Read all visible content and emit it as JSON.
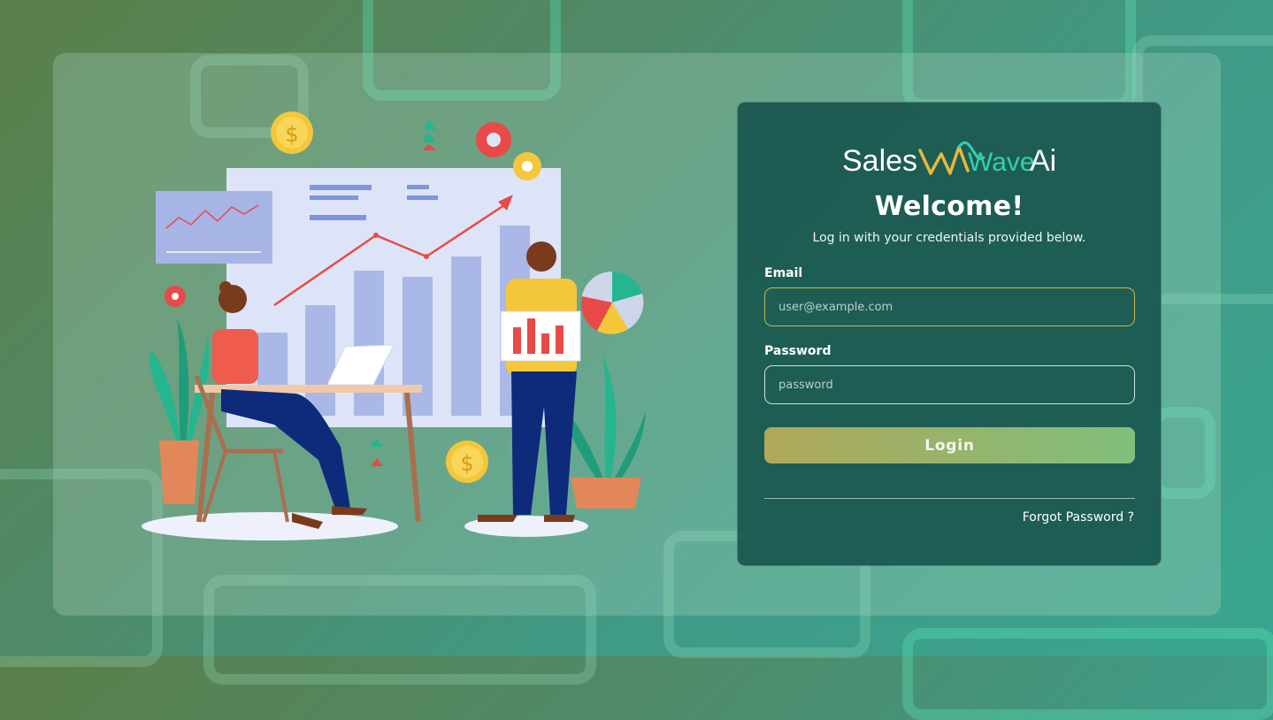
{
  "brand": {
    "name_part1": "Sales",
    "name_part2": "Wave",
    "name_part3": "Ai",
    "colors": {
      "accent_yellow": "#e6b93c",
      "accent_teal": "#36cdb0",
      "card_bg": "#16544c"
    }
  },
  "login": {
    "title": "Welcome!",
    "subtitle": "Log in with your credentials provided below.",
    "email_label": "Email",
    "email_placeholder": "user@example.com",
    "email_value": "",
    "password_label": "Password",
    "password_placeholder": "password",
    "password_value": "",
    "login_button": "Login",
    "forgot_password": "Forgot Password ?"
  },
  "icons": [
    "dollar-coin-icon",
    "gear-icon",
    "pie-chart-icon",
    "line-chart-icon",
    "plant-icon",
    "laptop-icon"
  ]
}
